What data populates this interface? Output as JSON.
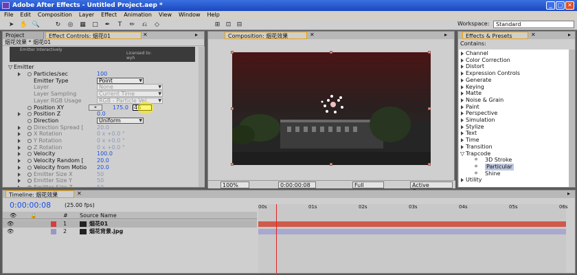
{
  "window": {
    "title": "Adobe After Effects - Untitled Project.aep *"
  },
  "menu": [
    "File",
    "Edit",
    "Composition",
    "Layer",
    "Effect",
    "Animation",
    "View",
    "Window",
    "Help"
  ],
  "workspace": {
    "label": "Workspace:",
    "value": "Standard"
  },
  "left_panel": {
    "tab_project": "Project",
    "tab_effect": "Effect Controls: 烟花01",
    "header": "烟花效果 * 烟花01",
    "license": {
      "interactive": "Emitter Interactively",
      "licensed": "Licensed to:",
      "user": "wyh"
    },
    "section": "Emitter",
    "rows": [
      {
        "label": "Particles/sec",
        "value": "100",
        "indent": 1,
        "tri": true,
        "sw": true,
        "dis": false
      },
      {
        "label": "Emitter Type",
        "value": "Point",
        "indent": 1,
        "dd": true,
        "dis": false
      },
      {
        "label": "Layer",
        "value": "None",
        "indent": 1,
        "dd": true,
        "dis": true
      },
      {
        "label": "Layer Sampling",
        "value": "Current Time",
        "indent": 1,
        "dd": true,
        "dis": true
      },
      {
        "label": "Layer RGB Usage",
        "value": "RGB - Particle Vel.",
        "indent": 1,
        "dd": true,
        "dis": true
      },
      {
        "label": "Position XY",
        "value": "175.0",
        "indent": 1,
        "sw": true,
        "dis": false,
        "extra": "46"
      },
      {
        "label": "Position Z",
        "value": "0.0",
        "indent": 1,
        "tri": true,
        "sw": true,
        "dis": false
      },
      {
        "label": "Direction",
        "value": "Uniform",
        "indent": 1,
        "dd": true,
        "sw": true,
        "dis": false
      },
      {
        "label": "Direction Spread [",
        "value": "20.0",
        "indent": 1,
        "tri": true,
        "sw": true,
        "dis": true
      },
      {
        "label": "X Rotation",
        "value": "0 x +0.0 °",
        "indent": 1,
        "tri": true,
        "sw": true,
        "dis": true
      },
      {
        "label": "Y Rotation",
        "value": "0 x +0.0 °",
        "indent": 1,
        "tri": true,
        "sw": true,
        "dis": true
      },
      {
        "label": "Z Rotation",
        "value": "0 x +0.0 °",
        "indent": 1,
        "tri": true,
        "sw": true,
        "dis": true
      },
      {
        "label": "Velocity",
        "value": "100.0",
        "indent": 1,
        "tri": true,
        "sw": true,
        "dis": false
      },
      {
        "label": "Velocity Random [",
        "value": "20.0",
        "indent": 1,
        "tri": true,
        "sw": true,
        "dis": false
      },
      {
        "label": "Velocity from Motio",
        "value": "20.0",
        "indent": 1,
        "tri": true,
        "sw": true,
        "dis": false
      },
      {
        "label": "Emitter Size X",
        "value": "50",
        "indent": 1,
        "tri": true,
        "sw": true,
        "dis": true
      },
      {
        "label": "Emitter Size Y",
        "value": "50",
        "indent": 1,
        "tri": true,
        "sw": true,
        "dis": true
      },
      {
        "label": "Emitter Size Z",
        "value": "50",
        "indent": 1,
        "tri": true,
        "sw": true,
        "dis": true
      }
    ]
  },
  "comp": {
    "tab": "Composition: 烟花效果",
    "zoom": "100%",
    "time": "0:00:00:08",
    "res": "Full",
    "camera": "Active Camera"
  },
  "effects": {
    "tab": "Effects & Presets",
    "contains": "Contains:",
    "items": [
      {
        "label": "Channel",
        "level": 0
      },
      {
        "label": "Color Correction",
        "level": 0
      },
      {
        "label": "Distort",
        "level": 0
      },
      {
        "label": "Expression Controls",
        "level": 0
      },
      {
        "label": "Generate",
        "level": 0
      },
      {
        "label": "Keying",
        "level": 0
      },
      {
        "label": "Matte",
        "level": 0
      },
      {
        "label": "Noise & Grain",
        "level": 0
      },
      {
        "label": "Paint",
        "level": 0
      },
      {
        "label": "Perspective",
        "level": 0
      },
      {
        "label": "Simulation",
        "level": 0
      },
      {
        "label": "Stylize",
        "level": 0
      },
      {
        "label": "Text",
        "level": 0
      },
      {
        "label": "Time",
        "level": 0
      },
      {
        "label": "Transition",
        "level": 0
      },
      {
        "label": "Trapcode",
        "level": 0,
        "open": true
      },
      {
        "label": "3D Stroke",
        "level": 1
      },
      {
        "label": "Particular",
        "level": 1,
        "selected": true
      },
      {
        "label": "Shine",
        "level": 1
      },
      {
        "label": "Utility",
        "level": 0
      }
    ]
  },
  "timeline": {
    "tab": "Timeline: 烟花效果",
    "timecode": "0:00:00:08",
    "fps": "(25.00 fps)",
    "col_hash": "#",
    "col_source": "Source Name",
    "layers": [
      {
        "num": "1",
        "name": "烟花01",
        "color": "#d04040"
      },
      {
        "num": "2",
        "name": "烟花背景.jpg",
        "color": "#9898c8"
      }
    ],
    "ticks": [
      "00s",
      "01s",
      "02s",
      "03s",
      "04s",
      "05s",
      "06s"
    ]
  }
}
